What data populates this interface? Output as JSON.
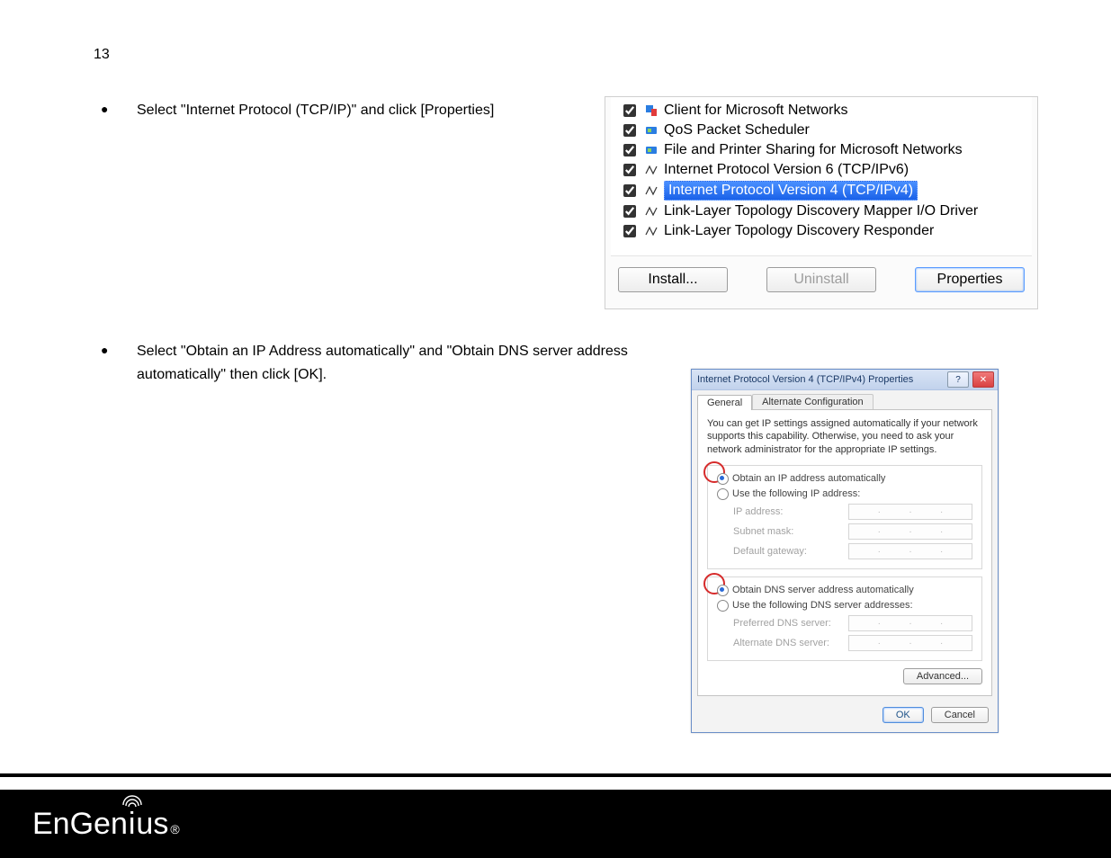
{
  "page_number": "13",
  "bullet1": "Select \"Internet Protocol (TCP/IP)\" and click [Properties]",
  "bullet2": "Select \"Obtain an IP Address automatically\" and \"Obtain DNS server address automatically\" then click [OK].",
  "protocol_list": {
    "items": [
      "Client for Microsoft Networks",
      "QoS Packet Scheduler",
      "File and Printer Sharing for Microsoft Networks",
      "Internet Protocol Version 6 (TCP/IPv6)",
      "Internet Protocol Version 4 (TCP/IPv4)",
      "Link-Layer Topology Discovery Mapper I/O Driver",
      "Link-Layer Topology Discovery Responder"
    ],
    "buttons": {
      "install": "Install...",
      "uninstall": "Uninstall",
      "properties": "Properties"
    }
  },
  "prop_dialog": {
    "title": "Internet Protocol Version 4 (TCP/IPv4) Properties",
    "tabs": {
      "general": "General",
      "alternate": "Alternate Configuration"
    },
    "intro": "You can get IP settings assigned automatically if your network supports this capability. Otherwise, you need to ask your network administrator for the appropriate IP settings.",
    "radios": {
      "auto_ip": "Obtain an IP address automatically",
      "manual_ip": "Use the following IP address:",
      "auto_dns": "Obtain DNS server address automatically",
      "manual_dns": "Use the following DNS server addresses:"
    },
    "fields": {
      "ip": "IP address:",
      "mask": "Subnet mask:",
      "gw": "Default gateway:",
      "pdns": "Preferred DNS server:",
      "adns": "Alternate DNS server:"
    },
    "buttons": {
      "advanced": "Advanced...",
      "ok": "OK",
      "cancel": "Cancel"
    }
  },
  "footer": {
    "brand_prefix": "EnGen",
    "brand_i": "i",
    "brand_suffix": "us",
    "registered": "®"
  }
}
